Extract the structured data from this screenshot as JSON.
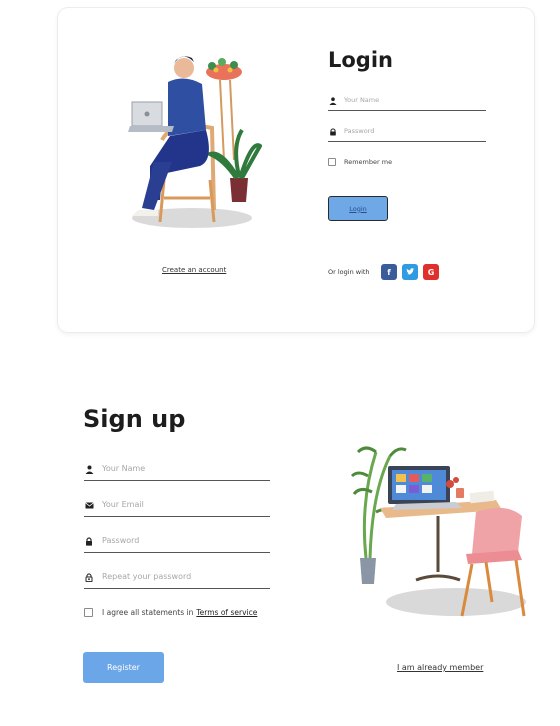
{
  "login": {
    "title": "Login",
    "name_placeholder": "Your Name",
    "password_placeholder": "Password",
    "remember_label": "Remember me",
    "button_label": "Login",
    "create_account_link": "Create an account",
    "social_label": "Or login with",
    "social": {
      "facebook": "f",
      "twitter": "t",
      "google": "G"
    },
    "colors": {
      "facebook": "#3b5c9b",
      "twitter": "#2f9be3",
      "google": "#e0302c",
      "button": "#6ea8e6"
    }
  },
  "signup": {
    "title": "Sign up",
    "name_placeholder": "Your Name",
    "email_placeholder": "Your Email",
    "password_placeholder": "Password",
    "repeat_placeholder": "Repeat your password",
    "agree_label": "I agree all statements in",
    "terms_link": "Terms of service",
    "register_label": "Register",
    "member_link": "I am already member",
    "colors": {
      "button": "#6ba6e8"
    }
  }
}
